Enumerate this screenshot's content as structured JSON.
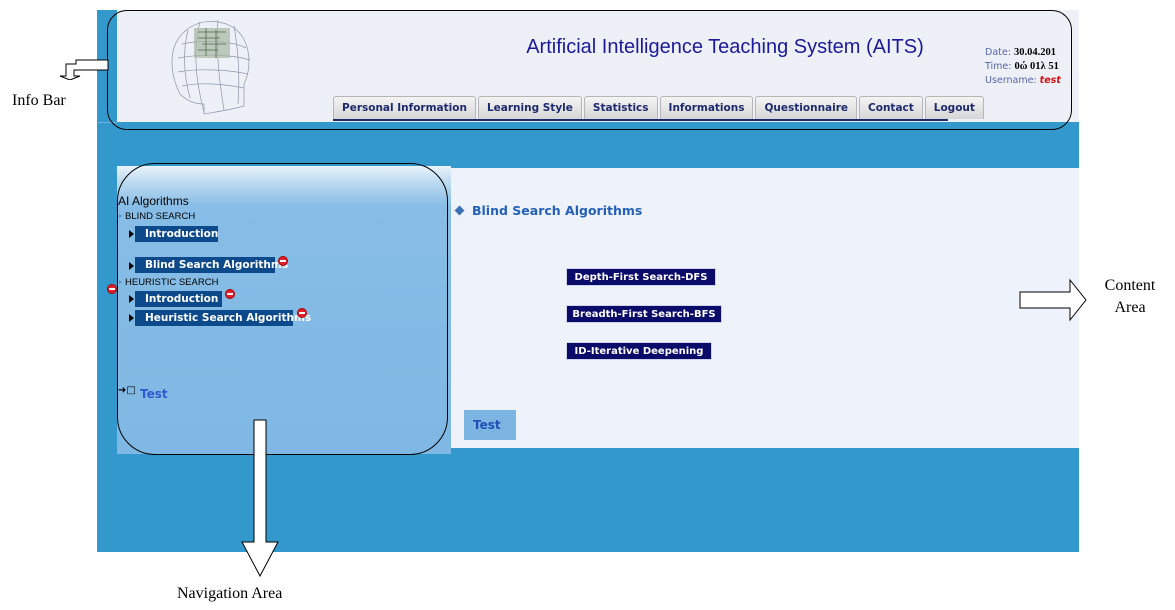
{
  "app": {
    "title": "Artificial Intelligence Teaching System (AITS)"
  },
  "session": {
    "date_label": "Date:",
    "date_value": "30.04.201",
    "time_label": "Time:",
    "time_value": "0ώ 01λ 51",
    "username_label": "Username:",
    "username_value": "test"
  },
  "tabs": [
    {
      "label": "Personal Information"
    },
    {
      "label": "Learning Style"
    },
    {
      "label": "Statistics"
    },
    {
      "label": "Informations"
    },
    {
      "label": "Questionnaire"
    },
    {
      "label": "Contact"
    },
    {
      "label": "Logout"
    }
  ],
  "navigation": {
    "root_title": "AI Algorithms",
    "blind_section": "BLIND SEARCH",
    "blind_items": [
      {
        "label": "Introduction"
      },
      {
        "label": "Blind Search Algorithms"
      }
    ],
    "heuristic_section": "HEURISTIC SEARCH",
    "heuristic_items": [
      {
        "label": "Introduction"
      },
      {
        "label": "Heuristic Search Algorithms"
      }
    ],
    "test_link": "Test"
  },
  "content": {
    "title": "Blind Search Algorithms",
    "algorithms": [
      {
        "label": "Depth-First Search-DFS"
      },
      {
        "label": "Breadth-First Search-BFS"
      },
      {
        "label": "ID-Iterative Deepening"
      }
    ],
    "test_button": "Test"
  },
  "annotations": {
    "info_bar": "Info Bar",
    "content_area_line1": "Content",
    "content_area_line2": "Area",
    "navigation_area": "Navigation Area"
  },
  "colors": {
    "frame_blue": "#3399cc",
    "nav_button": "#0c4a8c",
    "algo_button": "#0b0b6a",
    "title_blue": "#1a1a9a",
    "username_red": "#d41010"
  }
}
